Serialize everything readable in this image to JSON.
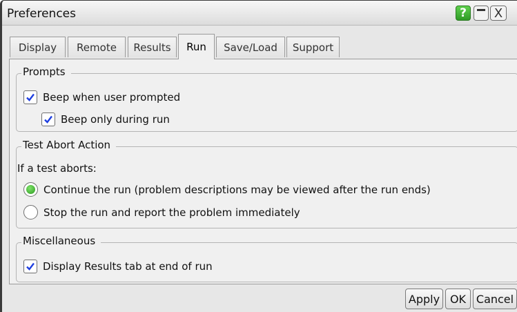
{
  "window": {
    "title": "Preferences",
    "help_label": "?",
    "close_label": "X"
  },
  "tabs": [
    {
      "label": "Display",
      "active": false
    },
    {
      "label": "Remote",
      "active": false
    },
    {
      "label": "Results",
      "active": false
    },
    {
      "label": "Run",
      "active": true
    },
    {
      "label": "Save/Load",
      "active": false
    },
    {
      "label": "Support",
      "active": false
    }
  ],
  "prompts": {
    "legend": "Prompts",
    "beep_when_prompted": {
      "label": "Beep when user prompted",
      "checked": true
    },
    "beep_only_during_run": {
      "label": "Beep only during run",
      "checked": true
    }
  },
  "abort": {
    "legend": "Test Abort Action",
    "intro": "If a test aborts:",
    "continue": {
      "label": "Continue the run (problem descriptions may be viewed after the run ends)",
      "selected": true
    },
    "stop": {
      "label": "Stop the run and report the problem immediately",
      "selected": false
    }
  },
  "misc": {
    "legend": "Miscellaneous",
    "display_results": {
      "label": "Display Results tab at end of run",
      "checked": true
    }
  },
  "buttons": {
    "apply": "Apply",
    "ok": "OK",
    "cancel": "Cancel"
  },
  "colors": {
    "checkmark": "#1f3fe0",
    "radio_selected": "#2c9a21",
    "help_button": "#3cb431"
  }
}
